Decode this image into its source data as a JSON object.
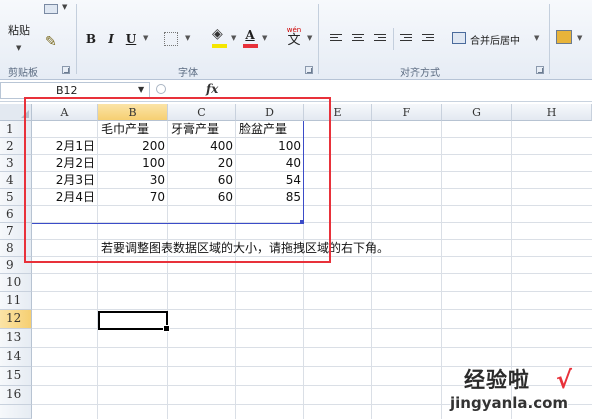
{
  "ribbon": {
    "clipboard": {
      "paste_label": "粘贴",
      "group_label": "剪贴板"
    },
    "font": {
      "bold": "B",
      "italic": "I",
      "underline": "U",
      "font_color_glyph": "A",
      "phonetic_glyph": "wén",
      "phonetic_char": "文",
      "group_label": "字体"
    },
    "alignment": {
      "merge_center_label": "合并后居中",
      "group_label": "对齐方式"
    }
  },
  "formula_bar": {
    "name_box": "B12",
    "fx_label": "fx",
    "formula": ""
  },
  "sheet": {
    "columns": [
      "A",
      "B",
      "C",
      "D",
      "E",
      "F",
      "G",
      "H"
    ],
    "rows": [
      "1",
      "2",
      "3",
      "4",
      "5",
      "6",
      "7",
      "8",
      "9",
      "10",
      "11",
      "12",
      "13",
      "14",
      "15",
      "16"
    ],
    "selected_column": "B",
    "selected_row": "12",
    "headers": [
      "毛巾产量",
      "牙膏产量",
      "脸盆产量"
    ],
    "data": [
      {
        "date": "2月1日",
        "b": "200",
        "c": "400",
        "d": "100"
      },
      {
        "date": "2月2日",
        "b": "100",
        "c": "20",
        "d": "40"
      },
      {
        "date": "2月3日",
        "b": "30",
        "c": "60",
        "d": "54"
      },
      {
        "date": "2月4日",
        "b": "70",
        "c": "60",
        "d": "85"
      }
    ],
    "note": "若要调整图表数据区域的大小，请拖拽区域的右下角。"
  },
  "colors": {
    "highlight_border": "#e8313a",
    "range_border": "#3b4cc8",
    "header_selected": "#f6cf72"
  },
  "watermark": {
    "logo_text": "经验啦",
    "check": "√",
    "url": "jingyanla.com"
  }
}
